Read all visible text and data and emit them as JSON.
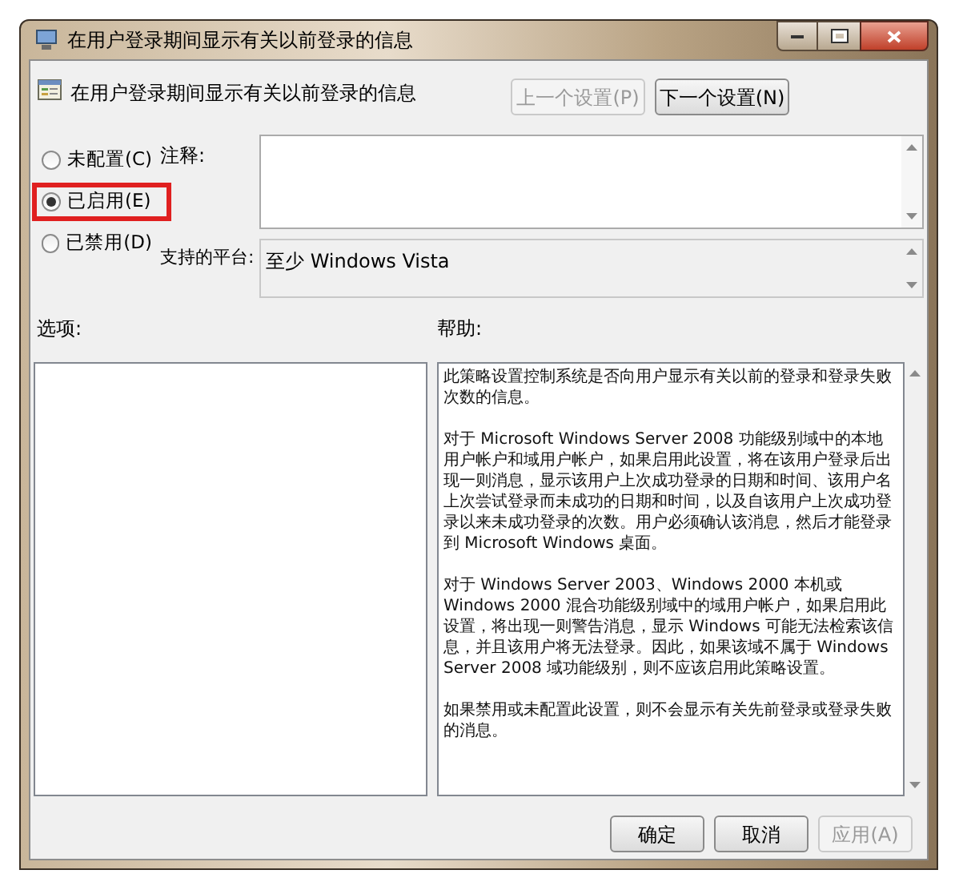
{
  "window": {
    "title": "在用户登录期间显示有关以前登录的信息"
  },
  "header": {
    "title": "在用户登录期间显示有关以前登录的信息"
  },
  "nav_buttons": [
    {
      "label": "上一个设置(P)",
      "disabled": true
    },
    {
      "label": "下一个设置(N)",
      "disabled": false
    }
  ],
  "state_options": [
    {
      "label": "未配置(C)",
      "selected": false,
      "highlighted": false
    },
    {
      "label": "已启用(E)",
      "selected": true,
      "highlighted": true
    },
    {
      "label": "已禁用(D)",
      "selected": false,
      "highlighted": false
    }
  ],
  "comment": {
    "label": "注释:"
  },
  "platform": {
    "label": "支持的平台:",
    "value": "至少 Windows Vista"
  },
  "options_panel": {
    "label": "选项:"
  },
  "help": {
    "label": "帮助:",
    "paragraphs": [
      "此策略设置控制系统是否向用户显示有关以前的登录和登录失败次数的信息。",
      "对于 Microsoft Windows Server 2008 功能级别域中的本地用户帐户和域用户帐户，如果启用此设置，将在该用户登录后出现一则消息，显示该用户上次成功登录的日期和时间、该用户名上次尝试登录而未成功的日期和时间，以及自该用户上次成功登录以来未成功登录的次数。用户必须确认该消息，然后才能登录到 Microsoft Windows 桌面。",
      "对于 Windows Server 2003、Windows 2000 本机或 Windows 2000 混合功能级别域中的域用户帐户，如果启用此设置，将出现一则警告消息，显示 Windows 可能无法检索该信息，并且该用户将无法登录。因此，如果该域不属于 Windows Server 2008 域功能级别，则不应该启用此策略设置。",
      "如果禁用或未配置此设置，则不会显示有关先前登录或登录失败的消息。"
    ]
  },
  "footer_buttons": [
    {
      "label": "确定",
      "disabled": false
    },
    {
      "label": "取消",
      "disabled": false
    },
    {
      "label": "应用(A)",
      "disabled": true
    }
  ]
}
